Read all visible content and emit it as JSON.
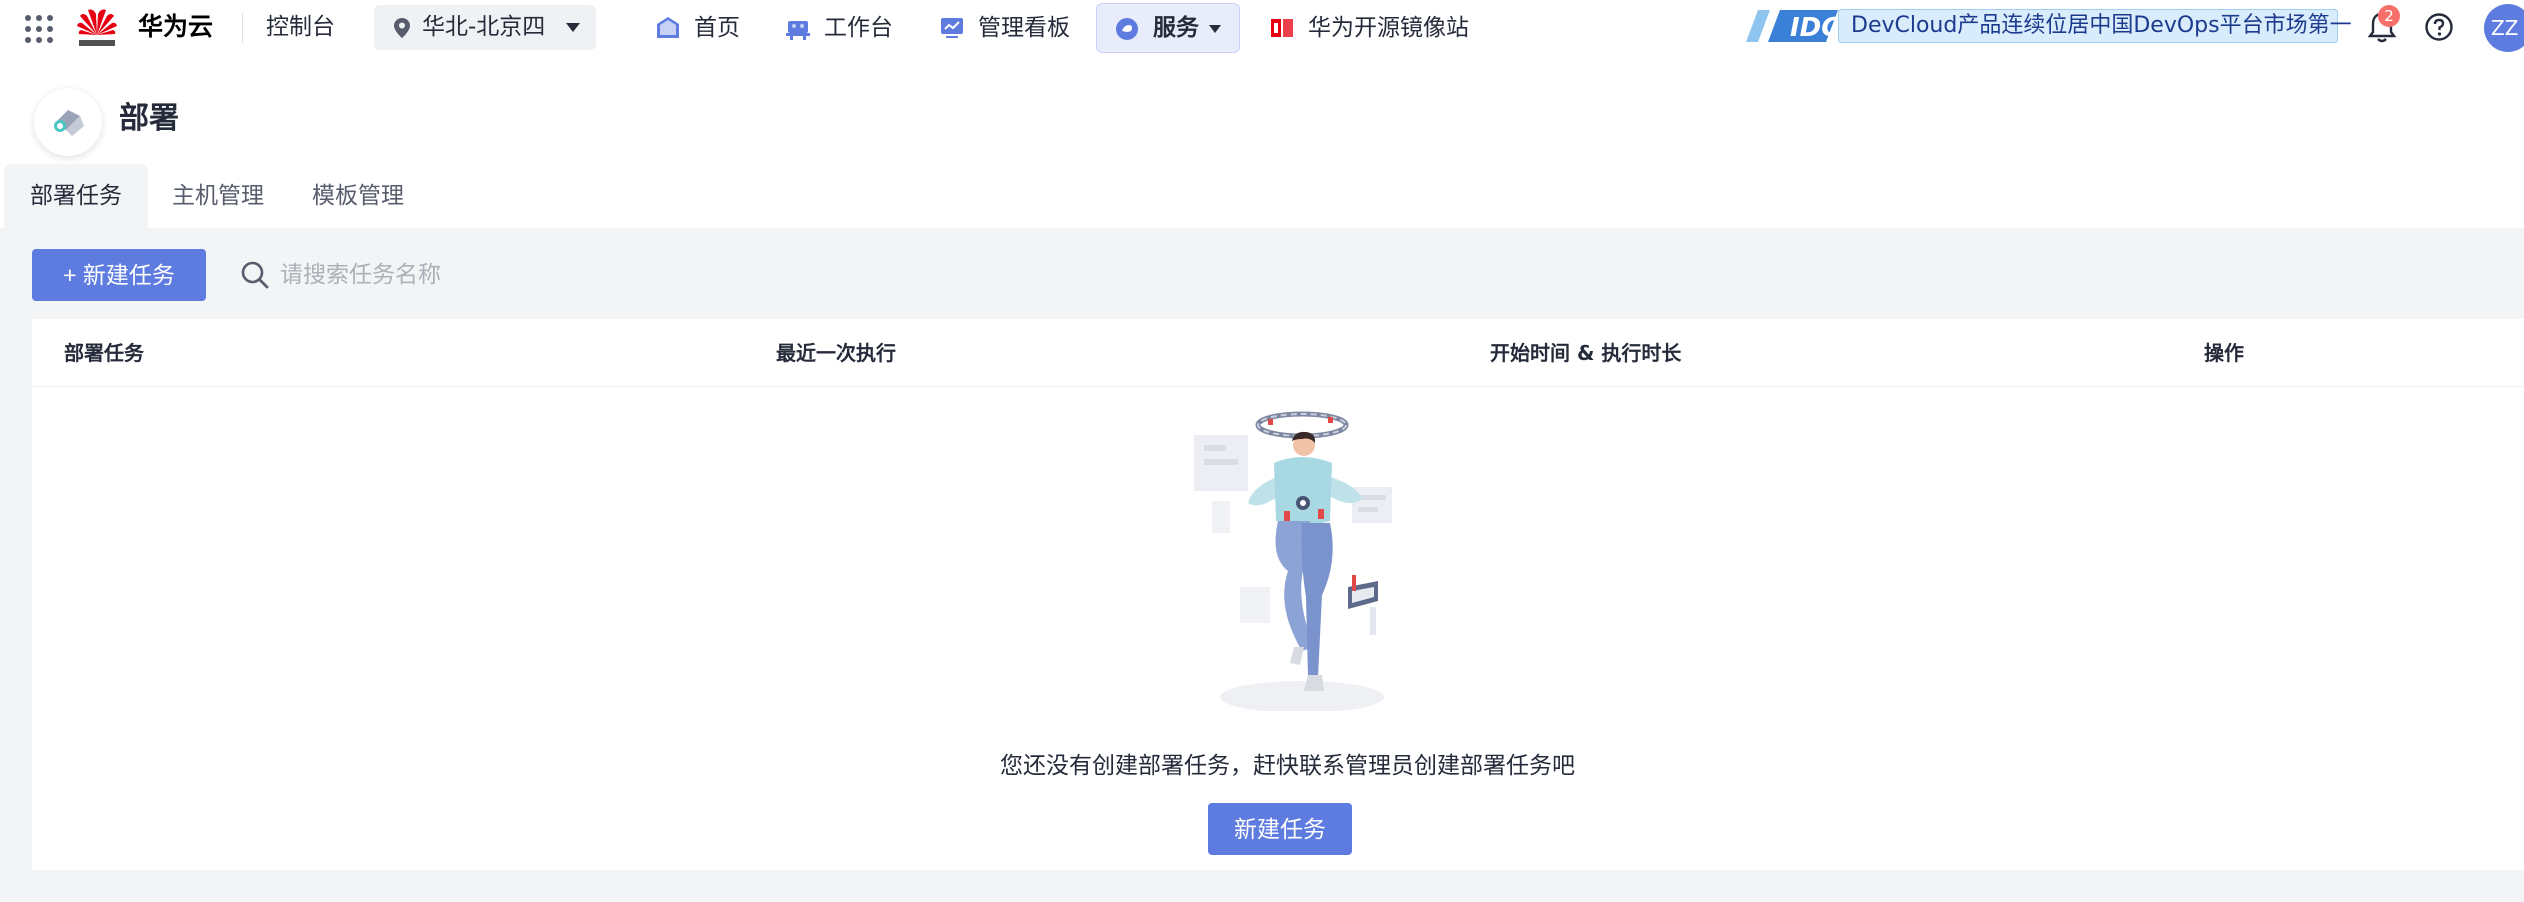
{
  "topbar": {
    "brand": "华为云",
    "console": "控制台",
    "region": "华北-北京四",
    "nav": [
      {
        "label": "首页",
        "icon": "home-icon"
      },
      {
        "label": "工作台",
        "icon": "workbench-icon"
      },
      {
        "label": "管理看板",
        "icon": "dashboard-icon"
      },
      {
        "label": "服务",
        "icon": "services-icon"
      },
      {
        "label": "华为开源镜像站",
        "icon": "mirror-icon"
      }
    ],
    "promo_text": "DevCloud产品连续位居中国DevOps平台市场第一",
    "promo_logo": "IDC",
    "notification_count": "2",
    "avatar_initials": "ZZ"
  },
  "page": {
    "title": "部署",
    "tabs": [
      "部署任务",
      "主机管理",
      "模板管理"
    ]
  },
  "toolbar": {
    "new_task_label": "+ 新建任务",
    "search_placeholder": "请搜索任务名称"
  },
  "table": {
    "columns": [
      "部署任务",
      "最近一次执行",
      "开始时间 & 执行时长",
      "操作"
    ],
    "rows": []
  },
  "empty_state": {
    "message": "您还没有创建部署任务，赶快联系管理员创建部署任务吧",
    "button_label": "新建任务"
  },
  "colors": {
    "primary": "#5e7ce0",
    "brand_red": "#e60012",
    "badge": "#f66f6a"
  }
}
